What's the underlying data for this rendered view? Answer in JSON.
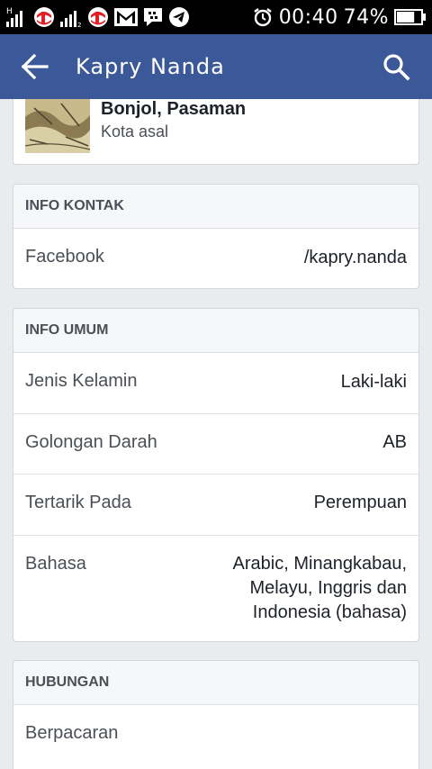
{
  "status_bar": {
    "time": "00:40",
    "battery_percent": "74%",
    "battery_level": 0.74,
    "icons": [
      "signal-h-icon",
      "telkomsel-icon",
      "signal-icon",
      "telkomsel-icon",
      "gmail-icon",
      "bbm-icon",
      "telegram-icon",
      "alarm-icon",
      "battery-icon"
    ]
  },
  "app_bar": {
    "title": "Kapry Nanda"
  },
  "hometown": {
    "name": "Bonjol, Pasaman",
    "label": "Kota asal"
  },
  "contact_info": {
    "header": "INFO KONTAK",
    "rows": [
      {
        "label": "Facebook",
        "value": "/kapry.nanda"
      }
    ]
  },
  "general_info": {
    "header": "INFO UMUM",
    "rows": [
      {
        "label": "Jenis Kelamin",
        "value": "Laki-laki"
      },
      {
        "label": "Golongan Darah",
        "value": "AB"
      },
      {
        "label": "Tertarik Pada",
        "value": "Perempuan"
      },
      {
        "label": "Bahasa",
        "value_lines": [
          "Arabic, Minangkabau,",
          "Melayu, Inggris dan",
          "Indonesia (bahasa)"
        ]
      }
    ]
  },
  "relationship": {
    "header": "HUBUNGAN",
    "status": "Berpacaran"
  },
  "colors": {
    "app_bar": "#3b5998",
    "background": "#e9ebee",
    "card_header": "#f6f7f9",
    "status_bar": "#000000",
    "telkomsel_red": "#e41e26"
  }
}
